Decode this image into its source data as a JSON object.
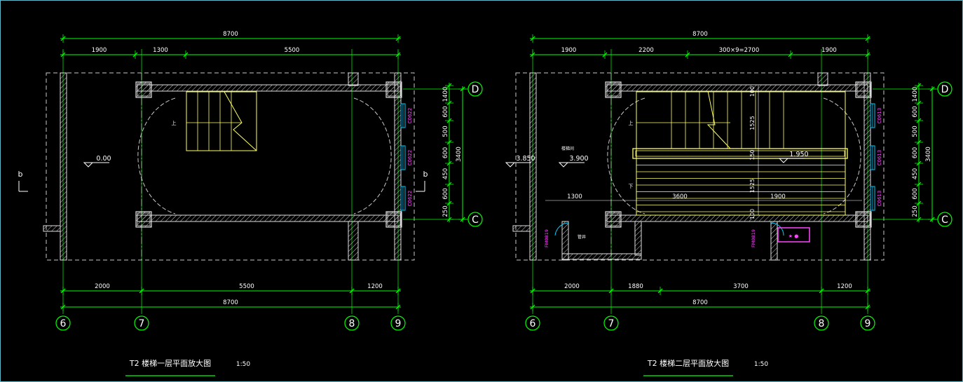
{
  "colors": {
    "background": "#000000",
    "frame": "#5fb8c8",
    "dimension": "#00ff00",
    "wall": "#e0e0e0",
    "hatch": "#c8c8c8",
    "stair": "#ffff66",
    "axis_grid": "#00ff00",
    "centerline": "#ffffff",
    "window_tag": "#ff44ff",
    "fixture": "#ff44ff",
    "door_swing": "#00ccff",
    "annotation": "#ffffff"
  },
  "plans": [
    {
      "title": "T2 楼梯一层平面放大图",
      "scale": "1:50",
      "top_total": "8700",
      "top_segments": [
        "1900",
        "1300",
        "5500"
      ],
      "bottom_segments": [
        "2000",
        "5500",
        "1200"
      ],
      "bottom_total": "8700",
      "grid_cols": [
        "6",
        "7",
        "8",
        "9"
      ],
      "grid_rows": [
        "D",
        "C"
      ],
      "right_dims": [
        "1400",
        "600",
        "500",
        "600",
        "450",
        "600",
        "250"
      ],
      "right_total": "3400",
      "level": "0.00",
      "windows": [
        "C0622",
        "C0622",
        "C0622"
      ],
      "section_marks": [
        "b",
        "b"
      ]
    },
    {
      "title": "T2 楼梯二层平面放大图",
      "scale": "1:50",
      "top_total": "8700",
      "top_segments": [
        "1900",
        "2200",
        "300×9=2700",
        "1900"
      ],
      "bottom_segments": [
        "2000",
        "1880",
        "3700",
        "1200"
      ],
      "bottom_total": "8700",
      "grid_cols": [
        "6",
        "7",
        "8",
        "9"
      ],
      "grid_rows": [
        "D",
        "C"
      ],
      "right_dims": [
        "1400",
        "600",
        "500",
        "600",
        "450",
        "600",
        "250"
      ],
      "right_total": "3400",
      "levels": [
        "3.850",
        "3.900",
        "1.950"
      ],
      "inner_dims": [
        "1300",
        "3600",
        "1900"
      ],
      "stair_dims": [
        "100",
        "1525",
        "150",
        "1525",
        "100"
      ],
      "windows": [
        "C0613",
        "C0613",
        "C0613"
      ],
      "door_tags": [
        "FM0819",
        "FM0819"
      ],
      "small_labels": [
        "楼梯间",
        "管井"
      ]
    }
  ]
}
